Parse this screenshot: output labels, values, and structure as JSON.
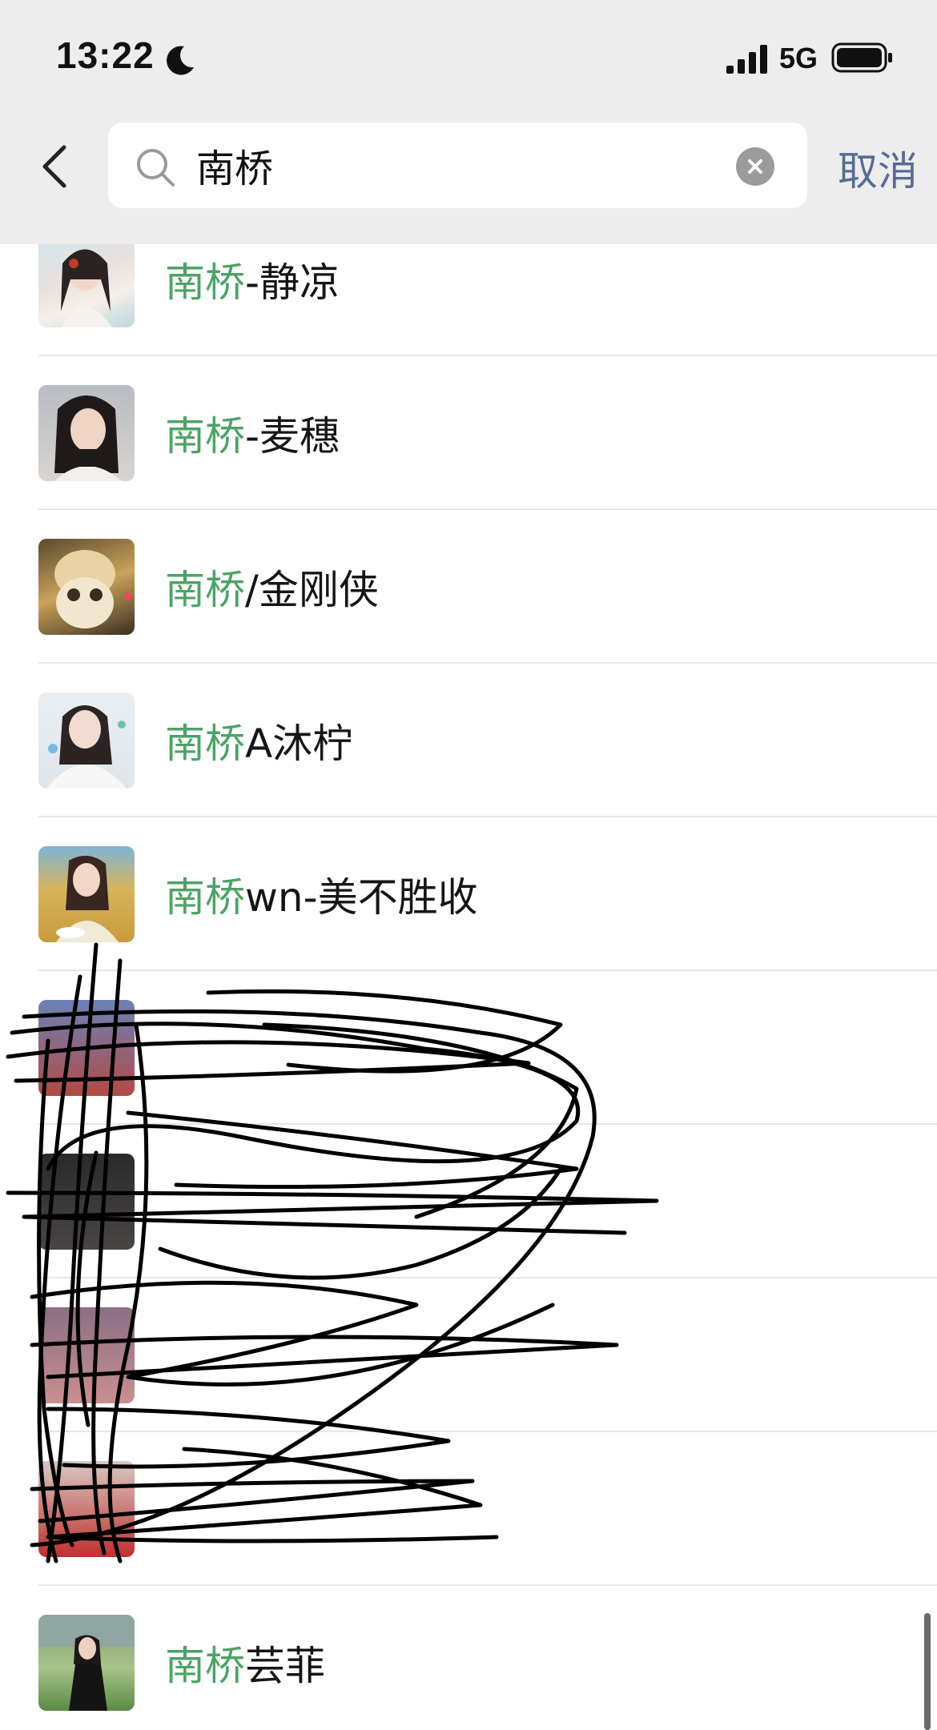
{
  "status_bar": {
    "time": "13:22",
    "network": "5G",
    "icons": [
      "moon-icon",
      "signal-icon",
      "battery-icon"
    ]
  },
  "search": {
    "query": "南桥",
    "placeholder": "",
    "cancel_label": "取消",
    "icons": [
      "back-icon",
      "search-icon",
      "clear-icon"
    ]
  },
  "colors": {
    "highlight": "#4ca366",
    "cancel": "#576b95",
    "header_bg": "#ededed"
  },
  "results": [
    {
      "highlight": "南桥",
      "rest": "-静凉"
    },
    {
      "highlight": "南桥",
      "rest": "-麦穗"
    },
    {
      "highlight": "南桥",
      "rest": "/金刚侠"
    },
    {
      "highlight": "南桥",
      "rest": "A沐柠"
    },
    {
      "highlight": "南桥",
      "rest": "wn-美不胜收"
    },
    {
      "highlight": "",
      "rest": ""
    },
    {
      "highlight": "",
      "rest": ""
    },
    {
      "highlight": "",
      "rest": ""
    },
    {
      "highlight": "",
      "rest": ""
    },
    {
      "highlight": "南桥",
      "rest": "芸菲"
    }
  ]
}
